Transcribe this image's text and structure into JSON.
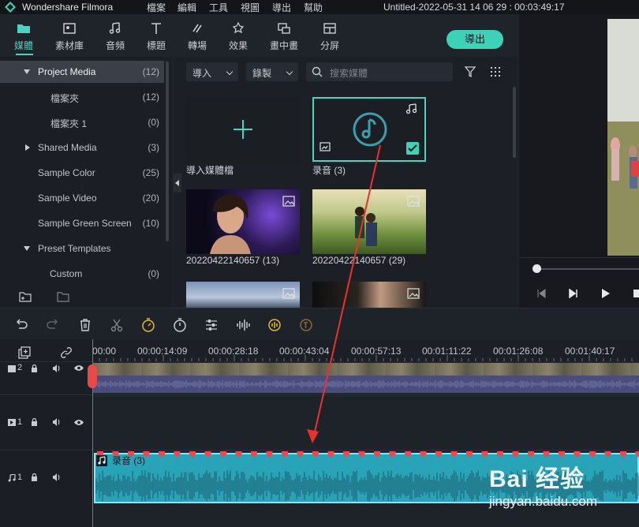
{
  "titlebar": {
    "app_name": "Wondershare Filmora",
    "menus": [
      "檔案",
      "編輯",
      "工具",
      "視圖",
      "導出",
      "幫助"
    ],
    "project": "Untitled-2022-05-31 14 06 29 : 00:03:49:17"
  },
  "toolbar": {
    "tabs": [
      {
        "label": "媒體",
        "icon": "folder-icon",
        "active": true
      },
      {
        "label": "素材庫",
        "icon": "image-icon"
      },
      {
        "label": "音頻",
        "icon": "music-note-icon"
      },
      {
        "label": "標題",
        "icon": "text-icon"
      },
      {
        "label": "轉場",
        "icon": "transition-icon"
      },
      {
        "label": "效果",
        "icon": "effects-icon"
      },
      {
        "label": "畫中畫",
        "icon": "pip-icon"
      },
      {
        "label": "分屏",
        "icon": "split-screen-icon"
      }
    ],
    "export_label": "導出",
    "accent": "#3dd1b8"
  },
  "sidebar": {
    "items": [
      {
        "label": "Project Media",
        "count": "(12)"
      },
      {
        "label": "檔案夾",
        "count": "(12)"
      },
      {
        "label": "檔案夾 1",
        "count": "(0)"
      },
      {
        "label": "Shared Media",
        "count": "(3)"
      },
      {
        "label": "Sample Color",
        "count": "(25)"
      },
      {
        "label": "Sample Video",
        "count": "(20)"
      },
      {
        "label": "Sample Green Screen",
        "count": "(10)"
      },
      {
        "label": "Preset Templates",
        "count": ""
      },
      {
        "label": "Custom",
        "count": "(0)"
      }
    ]
  },
  "media": {
    "import_label": "導入",
    "record_label": "錄製",
    "search_placeholder": "搜索媒體",
    "items": [
      {
        "caption": "導入媒體檔"
      },
      {
        "caption": "录音 (3)"
      },
      {
        "caption": "20220422140657 (13)"
      },
      {
        "caption": "20220422140657 (29)"
      }
    ]
  },
  "timeline": {
    "ruler": [
      "00:00",
      "00:00:14:09",
      "00:00:28:18",
      "00:00:43:04",
      "00:00:57:13",
      "00:01:11:22",
      "00:01:26:08",
      "00:01:40:17"
    ],
    "tracks": [
      {
        "num": "2"
      },
      {
        "num": "1"
      },
      {
        "num": "1"
      }
    ],
    "audio_clip_label": "录音 (3)"
  },
  "watermark": {
    "brand": "Bai 经验",
    "url": "jingyan.baidu.com"
  }
}
